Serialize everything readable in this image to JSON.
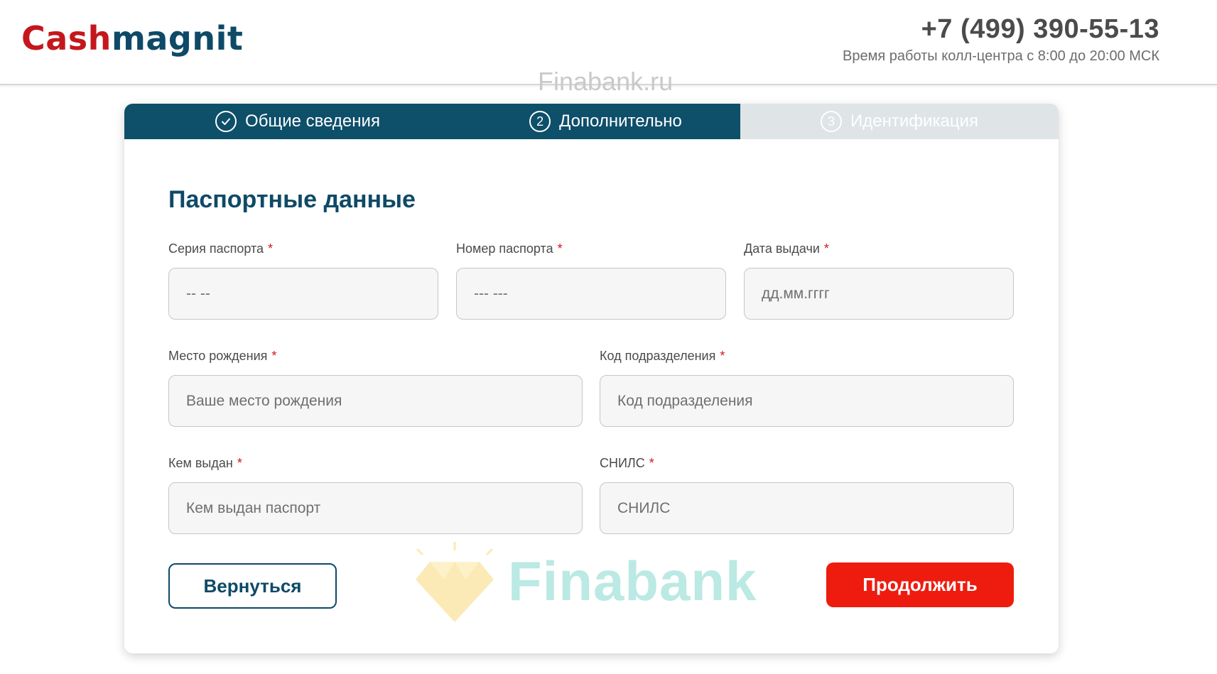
{
  "header": {
    "logo_part1": "Cash",
    "logo_part2": "magnit",
    "phone": "+7 (499) 390-55-13",
    "hours": "Время работы колл-центра с 8:00 до 20:00 МСК",
    "watermark": "Finabank.ru"
  },
  "steps": [
    {
      "number": "✓",
      "label": "Общие сведения",
      "state": "done"
    },
    {
      "number": "2",
      "label": "Дополнительно",
      "state": "active"
    },
    {
      "number": "3",
      "label": "Идентификация",
      "state": "pending"
    }
  ],
  "form": {
    "title": "Паспортные данные",
    "required_mark": "*",
    "fields": {
      "passport_series": {
        "label": "Серия паспорта",
        "placeholder": "-- --",
        "value": ""
      },
      "passport_number": {
        "label": "Номер паспорта",
        "placeholder": "--- ---",
        "value": ""
      },
      "issue_date": {
        "label": "Дата выдачи",
        "placeholder": "дд.мм.гггг",
        "value": ""
      },
      "birth_place": {
        "label": "Место рождения",
        "placeholder": "Ваше место рождения",
        "value": ""
      },
      "division_code": {
        "label": "Код подразделения",
        "placeholder": "Код подразделения",
        "value": ""
      },
      "issued_by": {
        "label": "Кем выдан",
        "placeholder": "Кем выдан паспорт",
        "value": ""
      },
      "snils": {
        "label": "СНИЛС",
        "placeholder": "СНИЛС",
        "value": ""
      }
    },
    "back_label": "Вернуться",
    "next_label": "Продолжить"
  },
  "watermark": {
    "text": "Finabank"
  },
  "colors": {
    "brand_red": "#c4171d",
    "brand_blue": "#0e4a67",
    "step_active_bg": "#0e4f6a",
    "step_pending_bg": "#dfe4e7",
    "button_primary": "#ee1c0f",
    "required_star": "#d5161c"
  },
  "icons": {
    "step1": "check-circle-icon",
    "step2": "number-circle-icon",
    "step3": "number-circle-icon",
    "watermark": "diamond-icon"
  }
}
